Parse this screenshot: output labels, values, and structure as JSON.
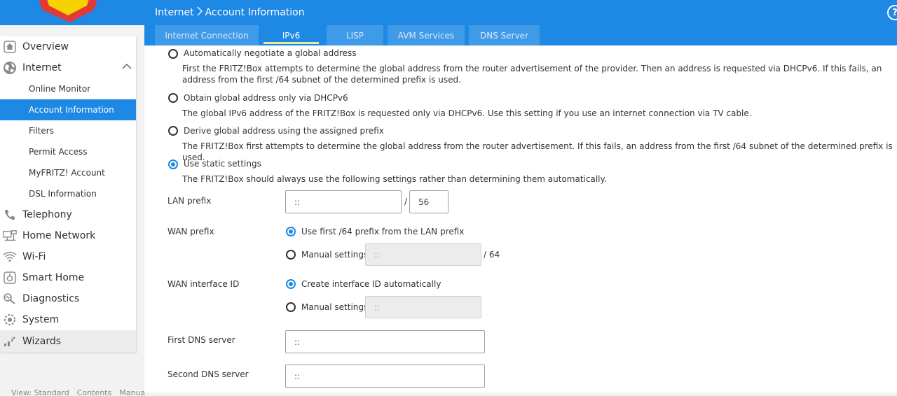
{
  "header": {
    "breadcrumb_parent": "Internet",
    "breadcrumb_current": "Account Information",
    "help_label": "?"
  },
  "tabs": [
    {
      "label": "Internet Connection",
      "active": false
    },
    {
      "label": "IPv6",
      "active": true
    },
    {
      "label": "LISP",
      "active": false
    },
    {
      "label": "AVM Services",
      "active": false
    },
    {
      "label": "DNS Server",
      "active": false
    }
  ],
  "sidebar": {
    "items": [
      {
        "label": "Overview",
        "icon": "home-icon"
      },
      {
        "label": "Internet",
        "icon": "globe-icon",
        "expanded": true
      },
      {
        "label": "Online Monitor"
      },
      {
        "label": "Account Information",
        "active": true
      },
      {
        "label": "Filters"
      },
      {
        "label": "Permit Access"
      },
      {
        "label": "MyFRITZ! Account"
      },
      {
        "label": "DSL Information"
      },
      {
        "label": "Telephony",
        "icon": "phone-icon"
      },
      {
        "label": "Home Network",
        "icon": "network-icon"
      },
      {
        "label": "Wi-Fi",
        "icon": "wifi-icon"
      },
      {
        "label": "Smart Home",
        "icon": "smart-home-icon"
      },
      {
        "label": "Diagnostics",
        "icon": "diagnostics-icon"
      },
      {
        "label": "System",
        "icon": "system-icon"
      },
      {
        "label": "Wizards",
        "icon": "wizards-icon"
      }
    ],
    "footer": [
      "View: Standard",
      "Contents",
      "Manual"
    ]
  },
  "address_options": [
    {
      "title": "Automatically negotiate a global address",
      "desc": "First the FRITZ!Box attempts to determine the global address from the router advertisement of the provider. Then an address is requested via DHCPv6. If this fails, an address from the first /64 subnet of the determined prefix is used.",
      "checked": false
    },
    {
      "title": "Obtain global address only via DHCPv6",
      "desc": "The global IPv6 address of the FRITZ!Box is requested only via DHCPv6. Use this setting if you use an internet connection via TV cable.",
      "checked": false
    },
    {
      "title": "Derive global address using the assigned prefix",
      "desc": "The FRITZ!Box first attempts to determine the global address from the router advertisement. If this fails, an address from the first /64 subnet of the determined prefix is used.",
      "checked": false
    },
    {
      "title": "Use static settings",
      "desc": "The FRITZ!Box should always use the following settings rather than determining them automatically.",
      "checked": true
    }
  ],
  "static": {
    "lan_prefix_label": "LAN prefix",
    "lan_prefix_value": "::",
    "lan_prefix_slash": "/",
    "lan_prefix_length": "56",
    "wan_prefix_label": "WAN prefix",
    "wan_prefix_auto": "Use first /64 prefix from the LAN prefix",
    "wan_prefix_manual": "Manual settings",
    "wan_prefix_manual_value": "::",
    "wan_prefix_suffix": "/ 64",
    "wan_iface_label": "WAN interface ID",
    "wan_iface_auto": "Create interface ID automatically",
    "wan_iface_manual": "Manual settings",
    "wan_iface_manual_value": "::",
    "dns1_label": "First DNS server",
    "dns1_value": "::",
    "dns2_label": "Second DNS server",
    "dns2_value": "::"
  }
}
